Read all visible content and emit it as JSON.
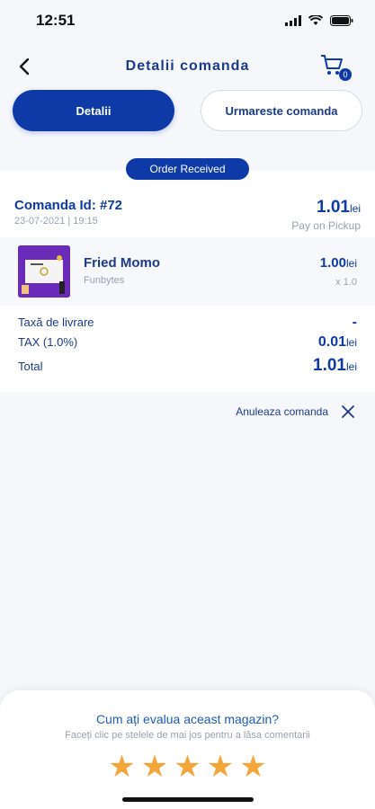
{
  "status_bar": {
    "time": "12:51"
  },
  "nav": {
    "title": "Detalii comanda",
    "cart_count": "0"
  },
  "tabs": {
    "active": "Detalii",
    "inactive": "Urmareste comanda"
  },
  "order_status": "Order Received",
  "order": {
    "id": "Comanda Id: #72",
    "date": "23-07-2021 | 19:15",
    "total": "1.01",
    "currency": "lei",
    "payment": "Pay on Pickup"
  },
  "item": {
    "name": "Fried Momo",
    "shop": "Funbytes",
    "price": "1.00",
    "currency": "lei",
    "qty": "x 1.0"
  },
  "summary": {
    "delivery_label": "Taxă de livrare",
    "delivery_value": "-",
    "tax_label": "TAX (1.0%)",
    "tax_value": "0.01",
    "total_label": "Total",
    "total_value": "1.01",
    "currency": "lei"
  },
  "cancel_label": "Anuleaza comanda",
  "rating": {
    "title": "Cum ați evalua aceast magazin?",
    "subtitle": "Faceți clic pe stelele de mai jos pentru a lăsa comentarii",
    "stars": 5
  },
  "colors": {
    "primary": "#0d3aa6",
    "star": "#f3a73a"
  }
}
